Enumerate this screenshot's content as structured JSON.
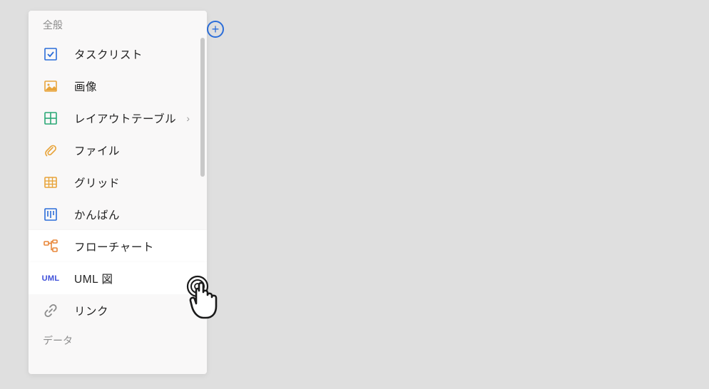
{
  "addButton": {
    "glyph": "+"
  },
  "menu": {
    "sections": [
      {
        "header": "全般",
        "items": [
          {
            "id": "tasklist",
            "label": "タスクリスト",
            "icon": "checkbox",
            "hasSubmenu": false,
            "highlighted": false
          },
          {
            "id": "image",
            "label": "画像",
            "icon": "image",
            "hasSubmenu": false,
            "highlighted": false
          },
          {
            "id": "layout-table",
            "label": "レイアウトテーブル",
            "icon": "table-grid",
            "hasSubmenu": true,
            "highlighted": false
          },
          {
            "id": "file",
            "label": "ファイル",
            "icon": "paperclip",
            "hasSubmenu": false,
            "highlighted": false
          },
          {
            "id": "grid",
            "label": "グリッド",
            "icon": "grid",
            "hasSubmenu": false,
            "highlighted": false
          },
          {
            "id": "kanban",
            "label": "かんばん",
            "icon": "kanban",
            "hasSubmenu": false,
            "highlighted": false
          },
          {
            "id": "flowchart",
            "label": "フローチャート",
            "icon": "flowchart",
            "hasSubmenu": false,
            "highlighted": true
          },
          {
            "id": "uml",
            "label": "UML 図",
            "icon": "uml",
            "hasSubmenu": false,
            "highlighted": true
          },
          {
            "id": "link",
            "label": "リンク",
            "icon": "link",
            "hasSubmenu": false,
            "highlighted": false
          }
        ]
      },
      {
        "header": "データ",
        "items": []
      }
    ]
  },
  "chevronGlyph": "›",
  "iconColors": {
    "checkbox": "#2b6dd9",
    "image": "#e8a43a",
    "table-grid": "#2aa876",
    "paperclip": "#e8a43a",
    "grid": "#e8a43a",
    "kanban": "#2b6dd9",
    "flowchart": "#e8873a",
    "uml": "#3e4fd9",
    "link": "#8a8a8a"
  }
}
